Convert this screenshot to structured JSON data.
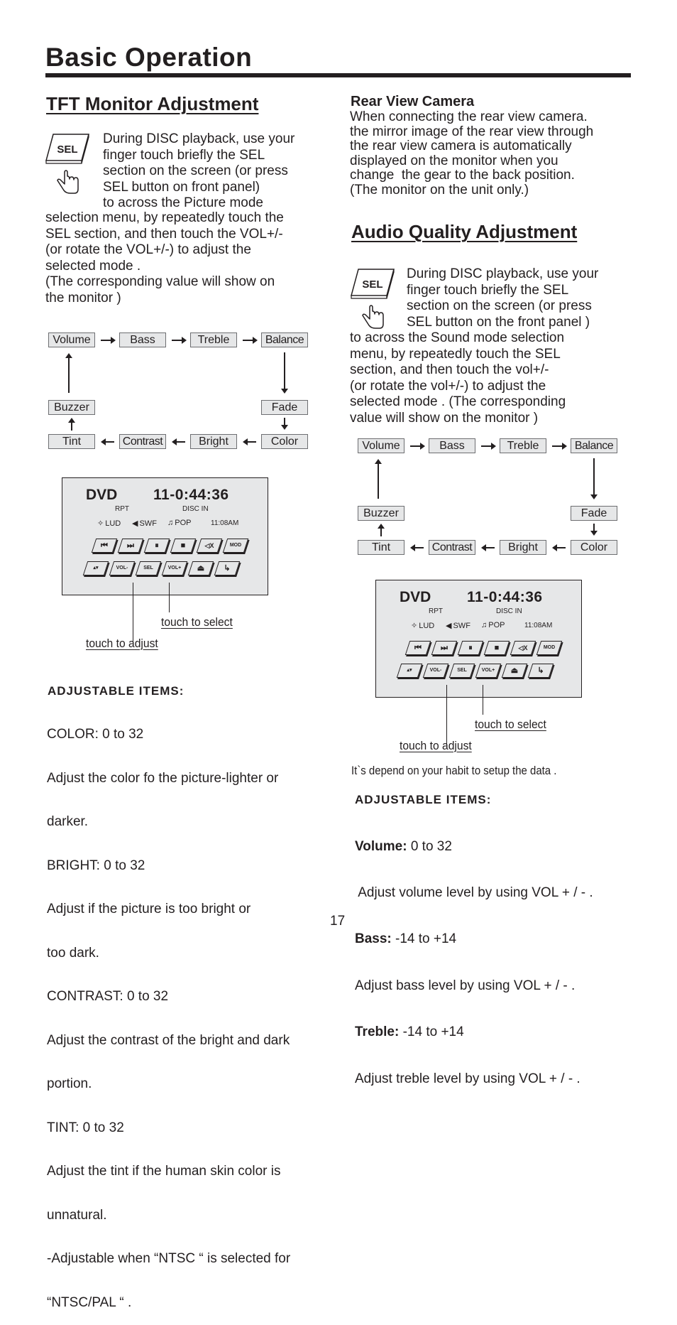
{
  "page": {
    "title": "Basic Operation",
    "page_number": "17"
  },
  "tft": {
    "heading": "TFT Monitor Adjustment",
    "intro_indented": "During DISC playback, use your\nfinger touch briefly the SEL\nsection on the screen (or press\nSEL button on front panel)\nto across the Picture mode",
    "intro_full": "selection menu, by repeatedly touch the\nSEL section, and then touch the VOL+/-\n(or rotate the VOL+/-) to adjust the\nselected mode .\n(The corresponding value will show on\nthe monitor )",
    "sel_icon_label": "SEL",
    "flow": [
      "Volume",
      "Bass",
      "Treble",
      "Balance",
      "Fade",
      "Color",
      "Bright",
      "Contrast",
      "Tint",
      "Buzzer"
    ],
    "callouts": {
      "select": "touch to select",
      "adjust": "touch to adjust"
    },
    "adjustable_heading": "ADJUSTABLE  ITEMS:",
    "adjustable_lines": [
      "COLOR: 0 to 32",
      "Adjust the color fo the picture-lighter or",
      "darker.",
      "BRIGHT: 0 to 32",
      "Adjust if the picture is too bright or",
      "too dark.",
      "CONTRAST: 0 to 32",
      "Adjust the contrast of the bright and dark",
      "portion.",
      "TINT: 0 to 32",
      "Adjust the tint if the human skin color is",
      "unnatural.",
      "-Adjustable when “NTSC “ is selected for",
      "“NTSC/PAL “ ."
    ]
  },
  "screen": {
    "source": "DVD",
    "time": "11-0:44:36",
    "rpt": "RPT",
    "disc": "DISC IN",
    "lud": "LUD",
    "swf": "SWF",
    "pop": "POP",
    "clock": "11:08AM",
    "row1": [
      {
        "name": "prev-track",
        "label": "⏮"
      },
      {
        "name": "next-track",
        "label": "⏭"
      },
      {
        "name": "pause",
        "label": "⏸"
      },
      {
        "name": "stop",
        "label": "■"
      },
      {
        "name": "mute",
        "label": "◁X"
      },
      {
        "name": "mode",
        "label": "MOD"
      }
    ],
    "row2": [
      {
        "name": "up-down",
        "label": "▴▾"
      },
      {
        "name": "vol-down",
        "label": "VOL-"
      },
      {
        "name": "sel",
        "label": "SEL"
      },
      {
        "name": "vol-up",
        "label": "VOL+"
      },
      {
        "name": "eject",
        "label": "⏏"
      },
      {
        "name": "return",
        "label": "↳"
      }
    ]
  },
  "rear": {
    "heading": "Rear View Camera",
    "text": "When connecting the rear view camera.\nthe mirror image of the rear view through\nthe rear view camera is automatically\ndisplayed on the monitor when you\nchange  the gear to the back position.\n(The monitor on the unit only.)"
  },
  "audio": {
    "heading": "Audio Quality Adjustment",
    "sel_icon_label": "SEL",
    "intro_indented": "During DISC playback, use your\nfinger touch briefly the SEL\nsection on the screen (or press\nSEL button on the front panel )",
    "intro_full": "to across the Sound mode selection\nmenu, by repeatedly touch the SEL\nsection, and then touch the vol+/-\n(or rotate the vol+/-) to adjust the\nselected mode . (The corresponding\nvalue will show on the monitor )",
    "flow": [
      "Volume",
      "Bass",
      "Treble",
      "Balance",
      "Fade",
      "Color",
      "Bright",
      "Contrast",
      "Tint",
      "Buzzer"
    ],
    "callouts": {
      "select": "touch to select",
      "adjust": "touch to adjust"
    },
    "note": "It`s depend on your habit to setup the data .",
    "adjustable_heading": "ADJUSTABLE  ITEMS:",
    "items": [
      {
        "name": "Volume:",
        "range": " 0 to 32",
        "desc": " Adjust volume level by using VOL + / - ."
      },
      {
        "name": "Bass:",
        "range": " -14 to +14",
        "desc": "Adjust bass level by using VOL + / - ."
      },
      {
        "name": "Treble:",
        "range": " -14 to +14",
        "desc": "Adjust treble level by using VOL + / - ."
      }
    ]
  }
}
